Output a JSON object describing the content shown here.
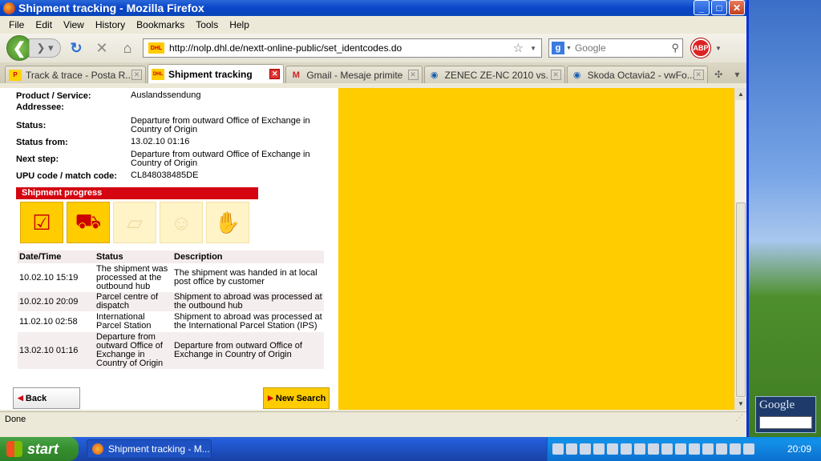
{
  "window": {
    "title": "Shipment tracking - Mozilla Firefox"
  },
  "menu": [
    "File",
    "Edit",
    "View",
    "History",
    "Bookmarks",
    "Tools",
    "Help"
  ],
  "address": {
    "url": "http://nolp.dhl.de/nextt-online-public/set_identcodes.do"
  },
  "search": {
    "placeholder": "Google"
  },
  "tabs": [
    {
      "label": "Track & trace - Posta R...",
      "icon": "posta-icon"
    },
    {
      "label": "Shipment tracking",
      "icon": "dhl-icon"
    },
    {
      "label": "Gmail - Mesaje primite",
      "icon": "gmail-icon"
    },
    {
      "label": "ZENEC ZE-NC 2010 vs. ...",
      "icon": "forum-icon"
    },
    {
      "label": "Skoda Octavia2 - vwFo...",
      "icon": "forum-icon"
    }
  ],
  "info": [
    {
      "label": "Product / Service:",
      "value": "Auslandssendung"
    },
    {
      "label": "Addressee:",
      "value": ""
    },
    {
      "label": "Status:",
      "value": "Departure from outward Office of Exchange in Country of Origin"
    },
    {
      "label": "Status from:",
      "value": "13.02.10 01:16"
    },
    {
      "label": "Next step:",
      "value": "Departure from outward Office of Exchange in Country of Origin"
    },
    {
      "label": "UPU code / match code:",
      "value": "CL848038485DE"
    }
  ],
  "progress": {
    "title": "Shipment progress"
  },
  "history": {
    "headers": [
      "Date/Time",
      "Status",
      "Description"
    ],
    "rows": [
      [
        "10.02.10 15:19",
        "The shipment was processed at the outbound hub",
        "The shipment was handed in at local post office by customer"
      ],
      [
        "10.02.10 20:09",
        "Parcel centre of dispatch",
        "Shipment to abroad was processed at the outbound hub"
      ],
      [
        "11.02.10 02:58",
        "International Parcel Station",
        "Shipment to abroad was processed at the International Parcel Station (IPS)"
      ],
      [
        "13.02.10 01:16",
        "Departure from outward Office of Exchange in Country of Origin",
        "Departure from outward Office of Exchange in Country of Origin"
      ]
    ]
  },
  "buttons": {
    "back": "Back",
    "new_search": "New Search"
  },
  "status_bar": "Done",
  "desktop": {
    "gadget_title": "Google"
  },
  "taskbar": {
    "start": "start",
    "task": "Shipment tracking - M...",
    "clock": "20:09"
  }
}
